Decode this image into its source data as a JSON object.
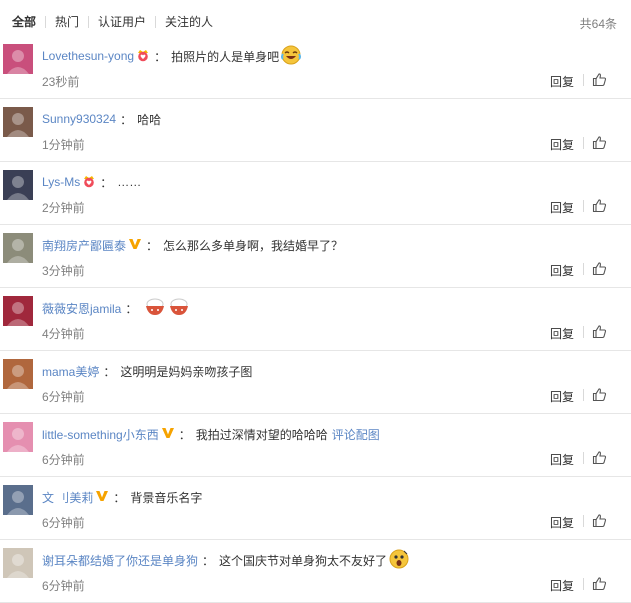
{
  "tabs": [
    {
      "label": "全部"
    },
    {
      "label": "热门"
    },
    {
      "label": "认证用户"
    },
    {
      "label": "关注的人"
    }
  ],
  "total_label": "共64条",
  "actions": {
    "reply_label": "回复",
    "like_icon": "thumbs-up-icon"
  },
  "colors": {
    "link": "#5b86c4",
    "text": "#333333",
    "muted": "#808080",
    "vip_gold": "#f6a300"
  },
  "comments": [
    {
      "user": "Lovethesun-yong",
      "badge": "crown-heart-icon",
      "colon": "：",
      "text": "拍照片的人是单身吧",
      "emoji": "laugh-cry-emoji",
      "time": "23秒前",
      "avatar_color": "#c94f7c"
    },
    {
      "user": "Sunny930324",
      "badge": "",
      "colon": "：",
      "text": "哈哈",
      "emoji": "",
      "time": "1分钟前",
      "avatar_color": "#7a5a4a"
    },
    {
      "user": "Lys-Ms",
      "badge": "crown-heart-icon",
      "colon": "：",
      "text": "……",
      "emoji": "",
      "time": "2分钟前",
      "avatar_color": "#3a3f55"
    },
    {
      "user": "南翔房产鄙匾泰",
      "badge": "verified-v-icon",
      "colon": "：",
      "text": "怎么那么多单身啊，我结婚早了？",
      "emoji": "",
      "time": "3分钟前",
      "avatar_color": "#8c8c7a"
    },
    {
      "user": "薇薇安恩jamila",
      "badge": "",
      "colon": "：",
      "text": "",
      "emoji": "double-rice-bowl-emoji",
      "time": "4分钟前",
      "avatar_color": "#a0283c"
    },
    {
      "user": "mama美婷",
      "badge": "",
      "colon": "：",
      "text": "这明明是妈妈亲吻孩子图",
      "emoji": "",
      "time": "6分钟前",
      "avatar_color": "#b0673d"
    },
    {
      "user": "little-something小东西",
      "badge": "verified-v-icon",
      "colon": "：",
      "text": "我拍过深情对望的哈哈哈",
      "link": "评论配图",
      "emoji": "",
      "time": "6分钟前",
      "avatar_color": "#e58fb0"
    },
    {
      "user": "文 刂美莉",
      "badge": "verified-v-icon",
      "colon": "：",
      "text": "背景音乐名字",
      "emoji": "",
      "time": "6分钟前",
      "avatar_color": "#5a6e8c"
    },
    {
      "user": "谢耳朵都结婚了你还是单身狗",
      "badge": "",
      "colon": "：",
      "text": "这个国庆节对单身狗太不友好了",
      "emoji": "shocked-face-emoji",
      "time": "6分钟前",
      "avatar_color": "#cfc6b8"
    }
  ]
}
